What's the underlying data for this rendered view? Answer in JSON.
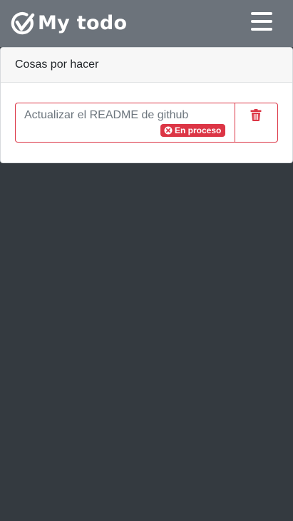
{
  "app": {
    "brand_name": "My todo",
    "logo_icon": "check-circle-logo-icon",
    "menu_icon": "hamburger-menu-icon"
  },
  "card": {
    "title": "Cosas por hacer"
  },
  "todos": [
    {
      "text": "Actualizar el README de github",
      "status": "En proceso",
      "status_icon": "times-circle-icon",
      "action_icon": "trash-icon"
    }
  ],
  "colors": {
    "navbar": "#6c737b",
    "background": "#343a40",
    "danger": "#dc3545",
    "card_header": "#f7f7f7"
  }
}
